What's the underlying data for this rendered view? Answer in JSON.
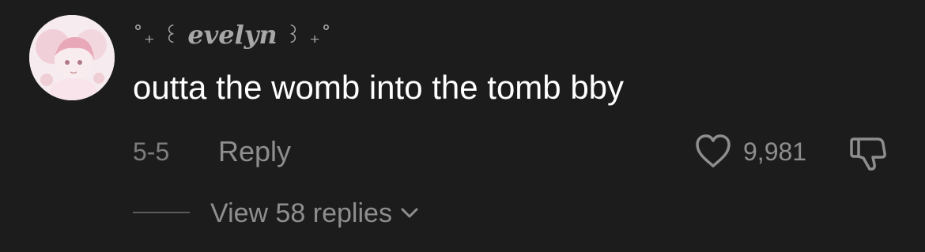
{
  "comment": {
    "username": {
      "prefix": "˚₊ ꒰",
      "name": "evelyn",
      "suffix": "꒱ ₊˚"
    },
    "text": "outta the womb into the tomb bby",
    "date": "5-5",
    "reply_label": "Reply",
    "like_count": "9,981",
    "view_replies_label": "View 58 replies"
  },
  "icons": {
    "like": "heart-outline-icon",
    "dislike": "thumbs-down-outline-icon",
    "expand": "chevron-down-icon",
    "avatar": "anime-character-avatar"
  },
  "colors": {
    "background": "#1c1c1c",
    "comment_text": "#ffffff",
    "secondary_text": "#8e8e8e",
    "avatar_background": "#f4e6ea"
  }
}
